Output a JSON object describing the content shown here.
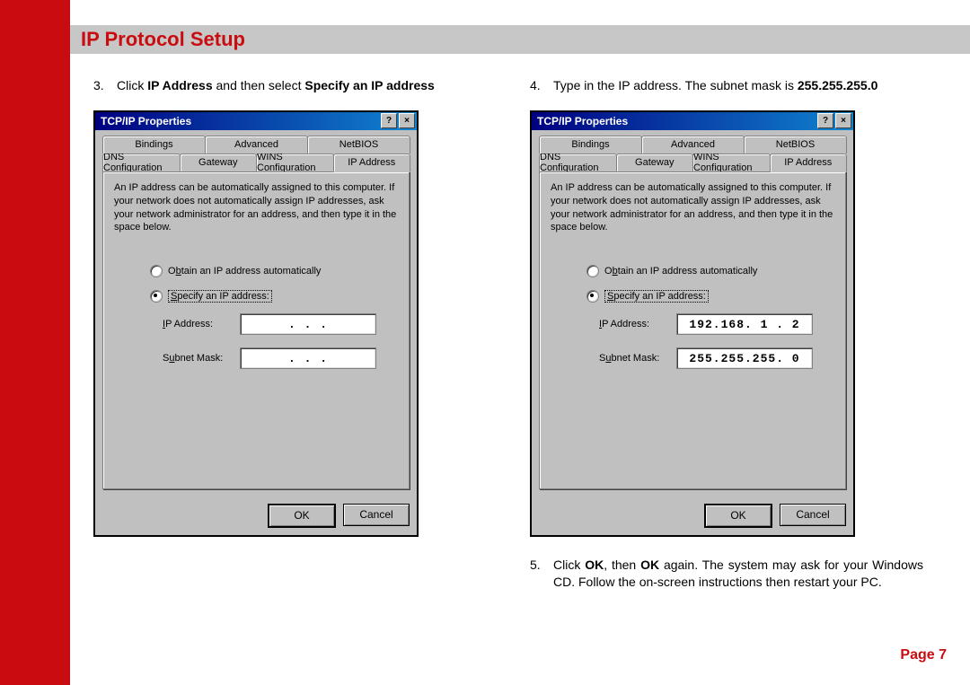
{
  "page": {
    "title": "IP Protocol Setup",
    "footer": "Page 7"
  },
  "steps": {
    "s3": {
      "num": "3.",
      "pre": "Click ",
      "b1": "IP Address",
      "mid": " and then select ",
      "b2": "Specify an IP address"
    },
    "s4": {
      "num": "4.",
      "pre": "Type in the IP address. The subnet mask is ",
      "b1": "255.255.255.0"
    },
    "s5": {
      "num": "5.",
      "pre": "Click ",
      "b1": "OK",
      "mid": ", then ",
      "b2": "OK",
      "post": " again. The system may ask for your Windows CD. Follow the on-screen instructions then restart your PC."
    }
  },
  "dialog": {
    "title": "TCP/IP Properties",
    "help_glyph": "?",
    "close_glyph": "×",
    "tabs_back": [
      "Bindings",
      "Advanced",
      "NetBIOS"
    ],
    "tabs_front": [
      "DNS Configuration",
      "Gateway",
      "WINS Configuration",
      "IP Address"
    ],
    "info": "An IP address can be automatically assigned to this computer. If your network does not automatically assign IP addresses, ask your network administrator for an address, and then type it in the space below.",
    "radio_obtain_pre": "O",
    "radio_obtain_u": "b",
    "radio_obtain_post": "tain an IP address automatically",
    "radio_specify_pre": "",
    "radio_specify_u": "S",
    "radio_specify_post": "pecify an IP address:",
    "label_ip_pre": "",
    "label_ip_u": "I",
    "label_ip_post": "P Address:",
    "label_mask_pre": "S",
    "label_mask_u": "u",
    "label_mask_post": "bnet Mask:",
    "ok": "OK",
    "cancel": "Cancel"
  },
  "values": {
    "left": {
      "ip": ".   .   .",
      "mask": ".   .   ."
    },
    "right": {
      "ip": "192.168. 1 . 2",
      "mask": "255.255.255. 0"
    }
  }
}
